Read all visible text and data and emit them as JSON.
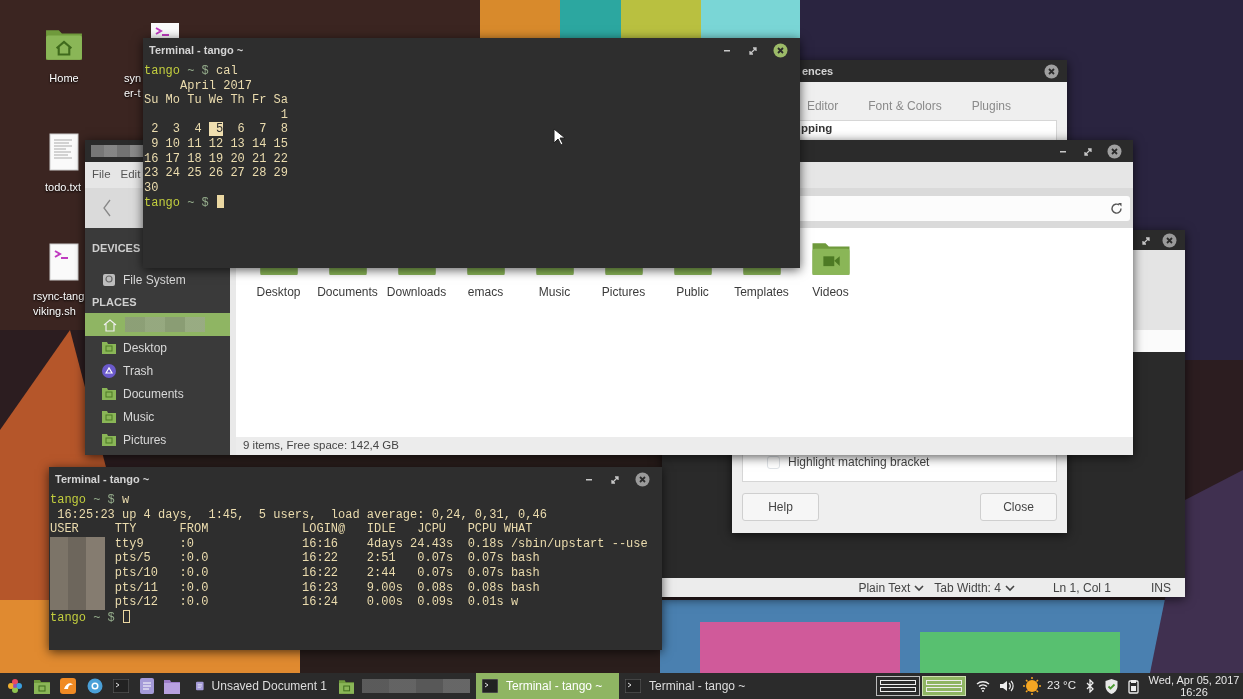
{
  "desktop_icons": [
    {
      "kind": "home",
      "lines": [
        "Home"
      ]
    },
    {
      "kind": "script",
      "lines": [
        "syn",
        "er-t"
      ]
    },
    {
      "kind": "text",
      "lines": [
        "todo.txt"
      ]
    },
    {
      "kind": "script",
      "lines": [
        "rsync-tang",
        "viking.sh"
      ]
    }
  ],
  "editor_window": {
    "status_bar": [
      {
        "kind": "dropdown",
        "text": "Plain Text"
      },
      {
        "kind": "dropdown",
        "text": "Tab Width:  4"
      },
      {
        "kind": "label",
        "text": "Ln 1, Col 1"
      },
      {
        "kind": "label",
        "text": "INS"
      }
    ]
  },
  "preferences_dialog": {
    "title": "ences",
    "tabs": [
      {
        "label": "Editor",
        "selected": false
      },
      {
        "label": "Font & Colors",
        "selected": false
      },
      {
        "label": "Plugins",
        "selected": false
      }
    ],
    "section_heading": "pping",
    "options": [
      {
        "label": "Highlight matching bracket",
        "checked": false
      }
    ],
    "buttons": [
      "Help",
      "Close"
    ]
  },
  "file_manager": {
    "title_hidden": true,
    "menu": [
      "File",
      "Edit"
    ],
    "sidebar": [
      {
        "title": "DEVICES",
        "items": [
          {
            "kind": "drive",
            "label": "File System",
            "selected": false
          }
        ]
      },
      {
        "title": "PLACES",
        "items": [
          {
            "kind": "home",
            "selected": true
          },
          {
            "kind": "folder",
            "label": "Desktop",
            "selected": false
          },
          {
            "kind": "trash",
            "label": "Trash",
            "selected": false
          },
          {
            "kind": "folder",
            "label": "Documents",
            "selected": false
          },
          {
            "kind": "folder",
            "label": "Music",
            "selected": false
          },
          {
            "kind": "folder",
            "label": "Pictures",
            "selected": false
          }
        ]
      }
    ],
    "items": [
      {
        "kind": "desktop",
        "label": "Desktop"
      },
      {
        "kind": "documents",
        "label": "Documents"
      },
      {
        "kind": "downloads",
        "label": "Downloads"
      },
      {
        "kind": "plain",
        "label": "emacs"
      },
      {
        "kind": "music",
        "label": "Music"
      },
      {
        "kind": "pictures",
        "label": "Pictures"
      },
      {
        "kind": "public",
        "label": "Public"
      },
      {
        "kind": "templates",
        "label": "Templates"
      },
      {
        "kind": "videos",
        "label": "Videos"
      }
    ],
    "status": "9 items, Free space: 142,4 GB"
  },
  "terminals": [
    {
      "title": "Terminal - tango ~",
      "focused": true,
      "lines": [
        [
          {
            "kind": "user",
            "text": "tango"
          },
          {
            "kind": "prompt",
            "text": " ~ $ "
          },
          {
            "kind": "output",
            "text": "cal"
          }
        ],
        "     April 2017",
        "Su Mo Tu We Th Fr Sa",
        "                   1",
        [
          {
            "kind": "output",
            "text": " 2  3  4  "
          },
          {
            "kind": "today",
            "text": "5"
          },
          {
            "kind": "output",
            "text": "  6  7  8"
          }
        ],
        " 9 10 11 12 13 14 15",
        "16 17 18 19 20 21 22",
        "23 24 25 26 27 28 29",
        "30",
        [
          {
            "kind": "user",
            "text": "tango"
          },
          {
            "kind": "prompt",
            "text": " ~ $ "
          }
        ]
      ]
    },
    {
      "title": "Terminal - tango ~",
      "focused": false,
      "user_column_hidden": true,
      "lines": [
        [
          {
            "kind": "user",
            "text": "tango"
          },
          {
            "kind": "prompt",
            "text": " ~ $ "
          },
          {
            "kind": "output",
            "text": "w"
          }
        ],
        " 16:25:23 up 4 days,  1:45,  5 users,  load average: 0,24, 0,31, 0,46",
        "USER     TTY      FROM             LOGIN@   IDLE   JCPU   PCPU WHAT",
        "         tty9     :0               16:16    4days 24.43s  0.18s /sbin/upstart --use",
        "         pts/5    :0.0             16:22    2:51   0.07s  0.07s bash",
        "         pts/10   :0.0             16:22    2:44   0.07s  0.07s bash",
        "         pts/11   :0.0             16:23    9.00s  0.08s  0.08s bash",
        "         pts/12   :0.0             16:24    0.00s  0.09s  0.01s w",
        [
          {
            "kind": "user",
            "text": "tango"
          },
          {
            "kind": "prompt",
            "text": " ~ $ "
          }
        ]
      ]
    }
  ],
  "taskbar": {
    "launchers": [
      {
        "kind": "menu"
      },
      {
        "kind": "files"
      },
      {
        "kind": "browser"
      },
      {
        "kind": "globe"
      },
      {
        "kind": "terminal"
      },
      {
        "kind": "editor"
      },
      {
        "kind": "folder"
      }
    ],
    "tasks": [
      {
        "kind": "editor",
        "label": "Unsaved Document 1",
        "selected": false
      },
      {
        "kind": "files",
        "selected": false
      },
      {
        "kind": "terminal",
        "label": "Terminal - tango ~",
        "selected": true
      },
      {
        "kind": "terminal",
        "label": "Terminal - tango ~",
        "selected": false
      }
    ],
    "workspaces": [
      {
        "selected": false
      },
      {
        "selected": true
      }
    ],
    "tray": [
      {
        "kind": "wifi"
      },
      {
        "kind": "volume"
      },
      {
        "kind": "weather",
        "text": "23 °C"
      },
      {
        "kind": "bluetooth"
      },
      {
        "kind": "shield"
      },
      {
        "kind": "clipboard"
      }
    ],
    "clock": [
      "Wed, Apr 05, 2017",
      "16:26"
    ]
  }
}
